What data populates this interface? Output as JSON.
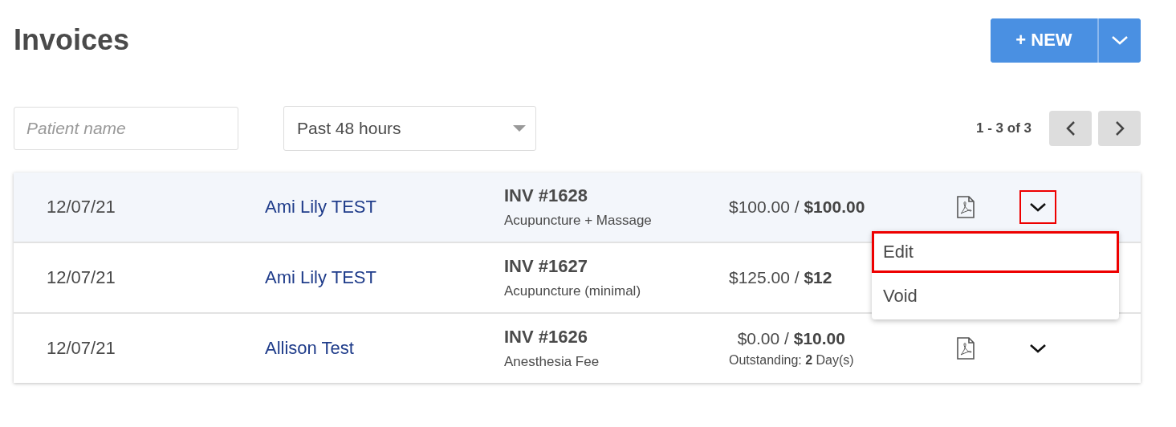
{
  "title": "Invoices",
  "new_button": {
    "label": "+ NEW"
  },
  "filters": {
    "patient_placeholder": "Patient name",
    "period": "Past 48 hours"
  },
  "pagination": {
    "range": "1 - 3 of 3"
  },
  "rows": [
    {
      "date": "12/07/21",
      "patient": "Ami Lily TEST",
      "invoice": "INV #1628",
      "description": "Acupuncture + Massage",
      "amount": "$100.00 / **$100.00**",
      "selected": true,
      "actions_visible": true,
      "menu_open": true
    },
    {
      "date": "12/07/21",
      "patient": "Ami Lily TEST",
      "invoice": "INV #1627",
      "description": "Acupuncture (minimal)",
      "amount": "$125.00 / **$12**",
      "selected": false,
      "actions_visible": false,
      "menu_open": false
    },
    {
      "date": "12/07/21",
      "patient": "Allison Test",
      "invoice": "INV #1626",
      "description": "Anesthesia Fee",
      "amount": "$0.00 / **$10.00**",
      "outstanding": "Outstanding: **2** Day(s)",
      "selected": false,
      "actions_visible": true,
      "menu_open": false
    }
  ],
  "menu": [
    {
      "label": "Edit",
      "selected": true
    },
    {
      "label": "Void",
      "selected": false
    }
  ]
}
